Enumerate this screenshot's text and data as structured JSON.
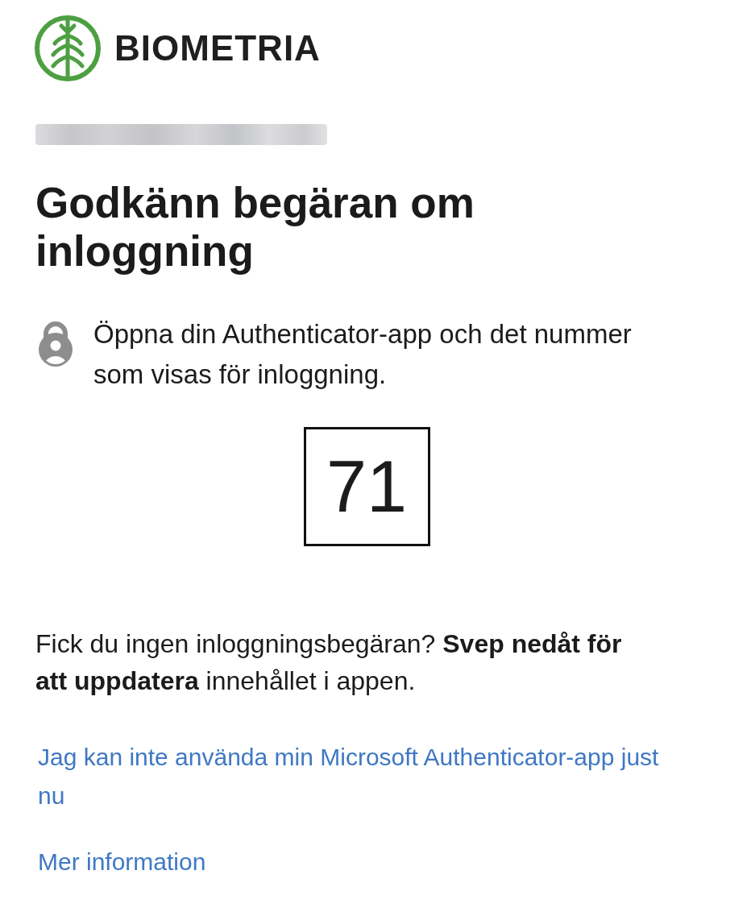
{
  "logo": {
    "name": "BIOMETRIA"
  },
  "title": "Godkänn begäran om inloggning",
  "instruction": "Öppna din Authenticator-app och det nummer som visas för inloggning.",
  "number": "71",
  "hint": "Fick du ingen inloggningsbegäran? **Svep nedåt för att uppdatera** innehållet i appen.",
  "links": [
    "Jag kan inte använda min Microsoft Authenticator-app just nu",
    "Mer information"
  ]
}
